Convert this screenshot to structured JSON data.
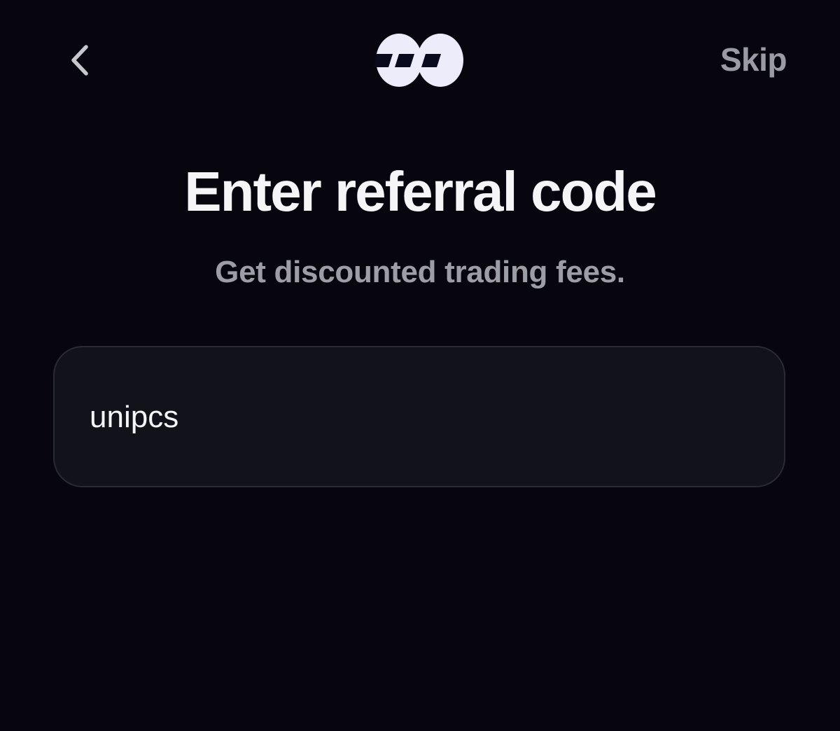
{
  "header": {
    "back_icon": "chevron-left-icon",
    "logo_icon": "app-logo-icon",
    "skip_label": "Skip"
  },
  "main": {
    "title": "Enter referral code",
    "subtitle": "Get discounted trading fees.",
    "referral_input": {
      "value": "unipcs",
      "placeholder": ""
    }
  },
  "colors": {
    "background": "#07060f",
    "field_background": "#12121a",
    "field_border": "#2a2a33",
    "primary_text": "#f5f5f7",
    "secondary_text": "#9d9ea5",
    "logo": "#ececfb"
  }
}
